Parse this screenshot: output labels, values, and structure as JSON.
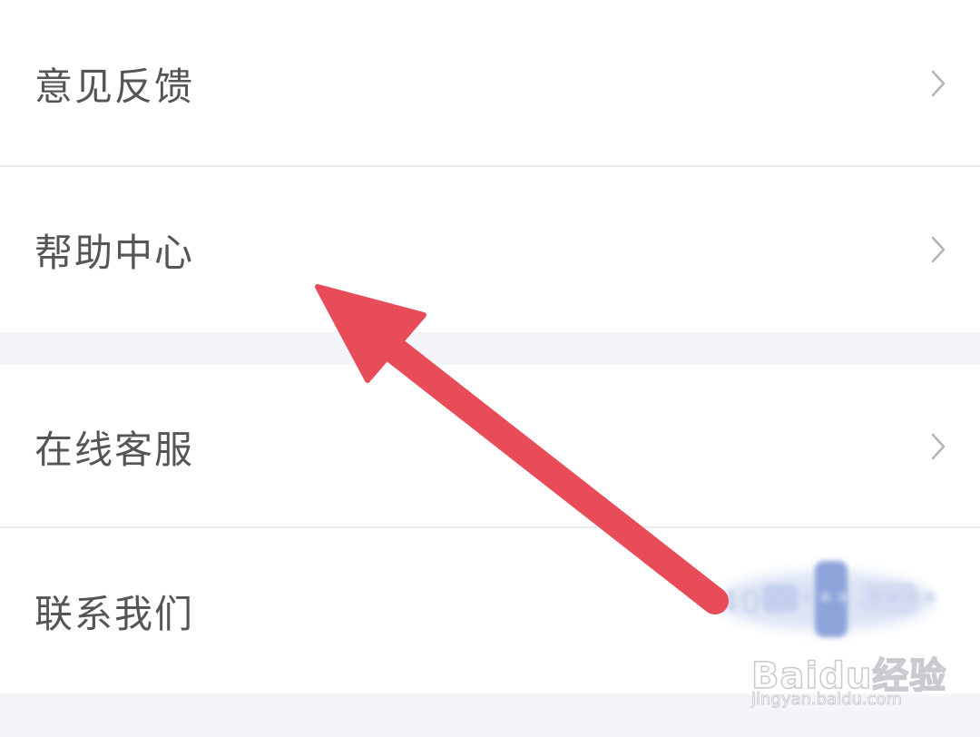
{
  "menu": {
    "items": [
      {
        "label": "意见反馈",
        "icon": "chevron-right-icon"
      },
      {
        "label": "帮助中心",
        "icon": "chevron-right-icon"
      },
      {
        "label": "在线客服",
        "icon": "chevron-right-icon"
      },
      {
        "label": "联系我们",
        "value": "400-***-****"
      }
    ]
  },
  "annotation": {
    "type": "arrow",
    "color": "#e84c59",
    "points_to": "帮助中心"
  },
  "watermark": {
    "brand": "Baidu经验",
    "url": "jingyan.baidu.com"
  },
  "colors": {
    "background": "#f4f5f9",
    "card": "#ffffff",
    "label": "#555558",
    "chevron": "#b5b5ba",
    "divider": "#ebebee"
  }
}
